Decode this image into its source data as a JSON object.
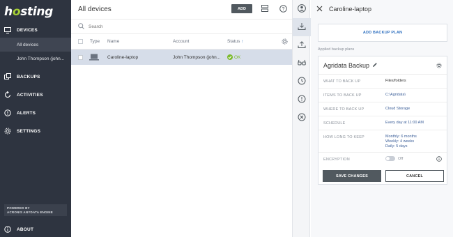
{
  "brand": {
    "logo": "hosting"
  },
  "sidebar": {
    "nav": [
      {
        "label": "DEVICES",
        "icon": "monitor-icon"
      },
      {
        "label": "BACKUPS",
        "icon": "backups-icon"
      },
      {
        "label": "ACTIVITIES",
        "icon": "activities-icon"
      },
      {
        "label": "ALERTS",
        "icon": "alert-icon"
      },
      {
        "label": "SETTINGS",
        "icon": "gear-icon"
      }
    ],
    "sub": [
      {
        "label": "All devices"
      },
      {
        "label": "John Thompson (john..."
      }
    ],
    "powered_line1": "POWERED BY",
    "powered_line2": "ACRONIS ANYDATA ENGINE",
    "about": "ABOUT",
    "colors": {
      "bg": "#2e3440",
      "accent": "#a6d036"
    }
  },
  "main": {
    "title": "All devices",
    "add_label": "ADD",
    "search_placeholder": "Search",
    "columns": [
      "Type",
      "Name",
      "Account",
      "Status"
    ],
    "rows": [
      {
        "type_icon": "laptop-icon",
        "name": "Caroline-laptop",
        "account": "John Thompson (john...",
        "status": "OK"
      }
    ]
  },
  "panel": {
    "title": "Caroline-laptop",
    "add_plan": "ADD BACKUP PLAN",
    "applied_label": "Applied backup plans",
    "plan": {
      "name": "Agridata Backup",
      "rows": [
        {
          "key": "WHAT TO BACK UP",
          "value": "Files/folders"
        },
        {
          "key": "ITEMS TO BACK UP",
          "value": "C:\\Agridata\\"
        },
        {
          "key": "WHERE TO BACK UP",
          "value": "Cloud Storage"
        },
        {
          "key": "SCHEDULE",
          "value": "Every day at 11:00 AM"
        },
        {
          "key": "HOW LONG TO KEEP",
          "value_lines": [
            "Monthly: 6 months",
            "Weekly: 4 weeks",
            "Daily: 5 days"
          ]
        },
        {
          "key": "ENCRYPTION",
          "toggle": "Off"
        }
      ],
      "save": "SAVE CHANGES",
      "cancel": "CANCEL"
    }
  }
}
